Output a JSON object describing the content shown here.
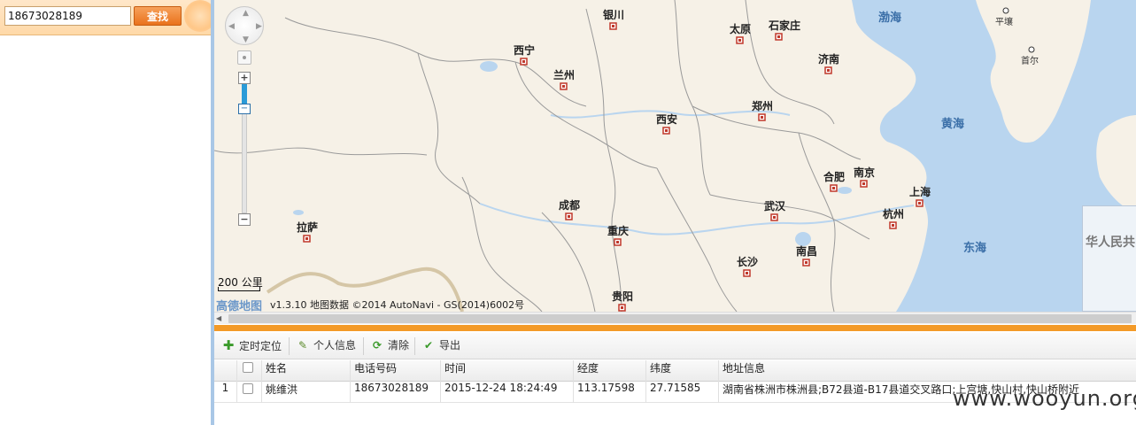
{
  "search": {
    "value": "18673028189",
    "button": "查找"
  },
  "map": {
    "cities": [
      {
        "name": "银川"
      },
      {
        "name": "太原"
      },
      {
        "name": "石家庄"
      },
      {
        "name": "西宁"
      },
      {
        "name": "兰州"
      },
      {
        "name": "济南"
      },
      {
        "name": "西安"
      },
      {
        "name": "郑州"
      },
      {
        "name": "合肥"
      },
      {
        "name": "南京"
      },
      {
        "name": "上海"
      },
      {
        "name": "成都"
      },
      {
        "name": "武汉"
      },
      {
        "name": "杭州"
      },
      {
        "name": "拉萨"
      },
      {
        "name": "重庆"
      },
      {
        "name": "长沙"
      },
      {
        "name": "南昌"
      },
      {
        "name": "贵阳"
      }
    ],
    "seas": [
      "渤海",
      "黄海",
      "东海"
    ],
    "foreign_cities": [
      "平壤",
      "首尔"
    ],
    "scale": "200 公里",
    "logo": "高德地图",
    "copyright": "v1.3.10 地图数据 ©2014 AutoNavi - GS(2014)6002号",
    "overview_text": "华人民共",
    "zoom_level_fraction": 0.85
  },
  "toolbar": {
    "locate": "定时定位",
    "personal": "个人信息",
    "clear": "清除",
    "export": "导出"
  },
  "grid": {
    "columns": [
      "姓名",
      "电话号码",
      "时间",
      "经度",
      "纬度",
      "地址信息"
    ],
    "rows": [
      {
        "index": "1",
        "name": "姚维洪",
        "phone": "18673028189",
        "time": "2015-12-24 18:24:49",
        "lng": "113.17598",
        "lat": "27.71585",
        "address": "湖南省株洲市株洲县;B72县道-B17县道交叉路口;上宫塘,快山村,快山桥附近"
      }
    ]
  },
  "watermark": "www.wooyun.org"
}
